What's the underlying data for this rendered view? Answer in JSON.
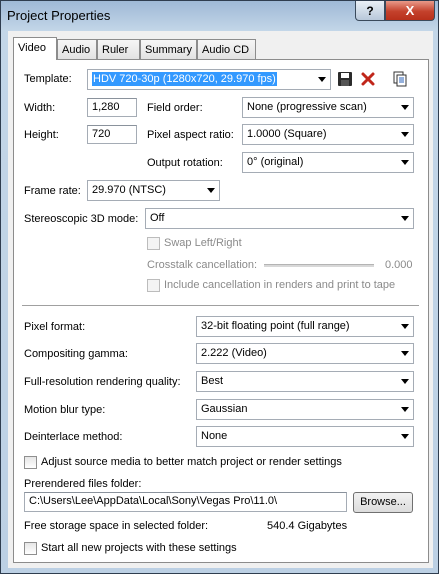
{
  "window": {
    "title": "Project Properties",
    "help_glyph": "?",
    "close_glyph": "X"
  },
  "tabs": [
    "Video",
    "Audio",
    "Ruler",
    "Summary",
    "Audio CD"
  ],
  "template": {
    "label": "Template:",
    "value": "HDV 720-30p (1280x720, 29.970 fps)",
    "icons": [
      "save-icon",
      "delete-icon",
      "match-media-icon"
    ]
  },
  "width": {
    "label": "Width:",
    "value": "1,280"
  },
  "height": {
    "label": "Height:",
    "value": "720"
  },
  "field_order": {
    "label": "Field order:",
    "value": "None (progressive scan)"
  },
  "pixel_aspect": {
    "label": "Pixel aspect ratio:",
    "value": "1.0000 (Square)"
  },
  "rotation": {
    "label": "Output rotation:",
    "value": "0° (original)"
  },
  "frame_rate": {
    "label": "Frame rate:",
    "value": "29.970 (NTSC)"
  },
  "stereo": {
    "label": "Stereoscopic 3D mode:",
    "value": "Off",
    "swap_label": "Swap Left/Right",
    "crosstalk_label": "Crosstalk cancellation:",
    "crosstalk_value": "0.000",
    "include_label": "Include cancellation in renders and print to tape"
  },
  "pixel_format": {
    "label": "Pixel format:",
    "value": "32-bit floating point (full range)"
  },
  "gamma": {
    "label": "Compositing gamma:",
    "value": "2.222 (Video)"
  },
  "quality": {
    "label": "Full-resolution rendering quality:",
    "value": "Best"
  },
  "motion_blur": {
    "label": "Motion blur type:",
    "value": "Gaussian"
  },
  "deinterlace": {
    "label": "Deinterlace method:",
    "value": "None"
  },
  "adjust_source_label": "Adjust source media to better match project or render settings",
  "prerendered": {
    "label": "Prerendered files folder:",
    "value": "C:\\Users\\Lee\\AppData\\Local\\Sony\\Vegas Pro\\11.0\\",
    "browse_label": "Browse..."
  },
  "free_space": {
    "label": "Free storage space in selected folder:",
    "value": "540.4 Gigabytes"
  },
  "start_all_label": "Start all new projects with these settings",
  "colors": {
    "selection": "#3399ff",
    "close_button": "#c4412c",
    "frame": "#bcd0e4"
  }
}
